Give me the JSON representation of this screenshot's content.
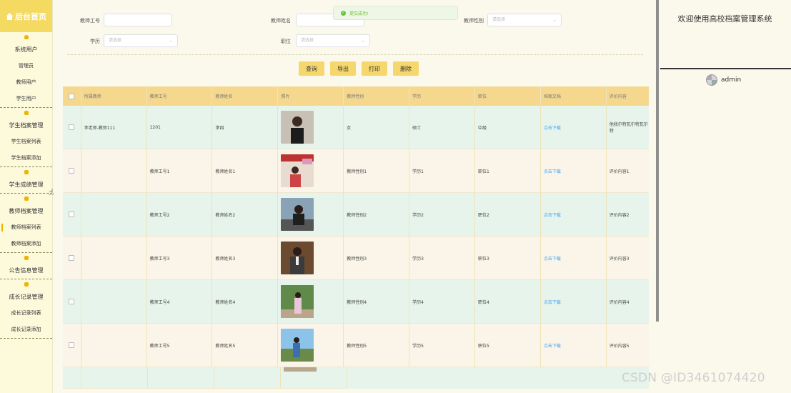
{
  "sidebar": {
    "logo": "后台首页",
    "groups": [
      {
        "label": "系统用户",
        "icon": "user-icon",
        "items": [
          "管理员",
          "教师用户",
          "学生用户"
        ]
      },
      {
        "label": "学生档案管理",
        "icon": "folder-icon",
        "items": [
          "学生档案列表",
          "学生档案添加"
        ]
      },
      {
        "label": "学生成绩管理",
        "icon": "folder-icon",
        "items": []
      },
      {
        "label": "教师档案管理",
        "icon": "folder-icon",
        "items": [
          "教师档案列表",
          "教师档案添加"
        ]
      },
      {
        "label": "公告信息管理",
        "icon": "folder-icon",
        "items": []
      },
      {
        "label": "成长记录管理",
        "icon": "folder-icon",
        "items": [
          "成长记录列表",
          "成长记录添加"
        ]
      }
    ],
    "active_item": "教师档案列表"
  },
  "toast": {
    "message": "提交成功!",
    "color": "#67c23a"
  },
  "filters": {
    "teacher_no_label": "教师工号",
    "teacher_name_label": "教师姓名",
    "teacher_gender_label": "教师性别",
    "gender_placeholder": "请选择",
    "education_label": "学历",
    "education_placeholder": "请选择",
    "position_label": "职位",
    "position_placeholder": "请选择"
  },
  "actions": {
    "query": "查询",
    "export": "导出",
    "print": "打印",
    "delete": "删除"
  },
  "table": {
    "headers": [
      "所属教师",
      "教师工号",
      "教师姓名",
      "照片",
      "教师性别",
      "学历",
      "职位",
      "档案文档",
      "评价内容"
    ],
    "rows": [
      {
        "owner": "李老师-教师111",
        "no": "1201",
        "name": "李四",
        "gender": "女",
        "edu": "硕士",
        "pos": "中级",
        "doc": "点击下载",
        "eval": "他我尔特瓦尔特瓦尔特"
      },
      {
        "owner": "",
        "no": "教师工号1",
        "name": "教师姓名1",
        "gender": "教师性别1",
        "edu": "学历1",
        "pos": "职位1",
        "doc": "点击下载",
        "eval": "评价内容1"
      },
      {
        "owner": "",
        "no": "教师工号2",
        "name": "教师姓名2",
        "gender": "教师性别2",
        "edu": "学历2",
        "pos": "职位2",
        "doc": "点击下载",
        "eval": "评价内容2"
      },
      {
        "owner": "",
        "no": "教师工号3",
        "name": "教师姓名3",
        "gender": "教师性别3",
        "edu": "学历3",
        "pos": "职位3",
        "doc": "点击下载",
        "eval": "评价内容3"
      },
      {
        "owner": "",
        "no": "教师工号4",
        "name": "教师姓名4",
        "gender": "教师性别4",
        "edu": "学历4",
        "pos": "职位4",
        "doc": "点击下载",
        "eval": "评价内容4"
      },
      {
        "owner": "",
        "no": "教师工号5",
        "name": "教师姓名5",
        "gender": "教师性别5",
        "edu": "学历5",
        "pos": "职位5",
        "doc": "点击下载",
        "eval": "评价内容5"
      }
    ]
  },
  "right_panel": {
    "welcome": "欢迎使用高校档案管理系统",
    "username": "admin"
  },
  "watermark": "CSDN @ID3461074420",
  "colors": {
    "accent": "#f5da62",
    "button": "#f5d76e",
    "header": "#f5d88e",
    "row_green": "#e6f4ec",
    "row_cream": "#faf5e8",
    "link": "#409eff"
  }
}
